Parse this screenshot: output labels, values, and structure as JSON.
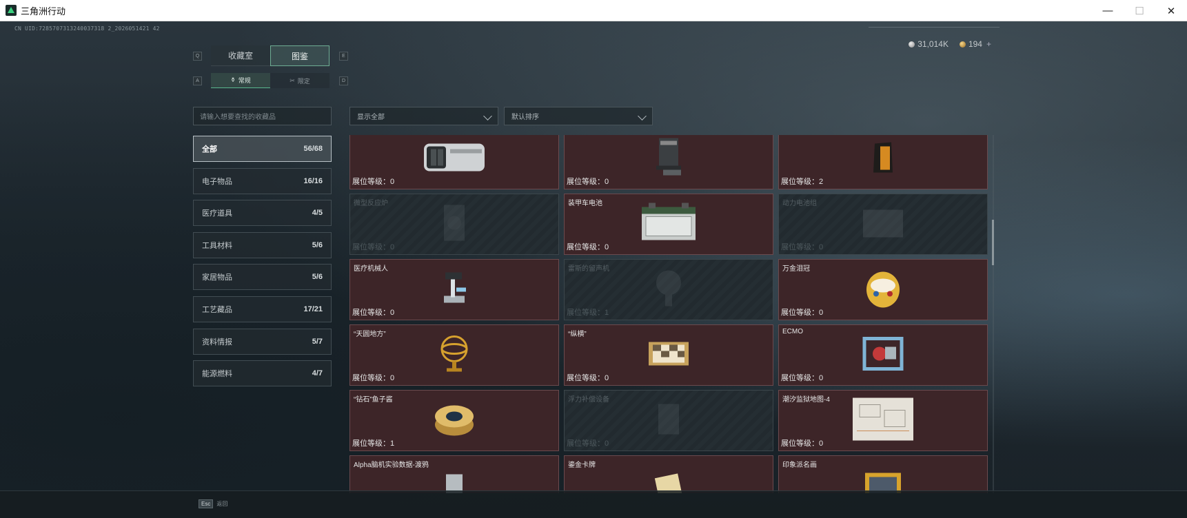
{
  "window": {
    "title": "三角洲行动",
    "minimize": "—",
    "maximize": "☐",
    "close": "✕"
  },
  "uid": "CN UID:7285707313240037318 2_2026051421 42",
  "currency": {
    "silver": "31,014K",
    "gold": "194",
    "add": "+"
  },
  "tabs": {
    "left_key": "Q",
    "right_key": "E",
    "items": [
      {
        "label": "收藏室"
      },
      {
        "label": "图鉴"
      }
    ]
  },
  "subtabs": {
    "left_key": "A",
    "right_key": "D",
    "items": [
      {
        "label": "常规",
        "icon": "⚱"
      },
      {
        "label": "限定",
        "icon": "✂"
      }
    ]
  },
  "search": {
    "placeholder": "请输入想要查找的收藏品"
  },
  "filters": {
    "show": "显示全部",
    "sort": "默认排序"
  },
  "categories": [
    {
      "label": "全部",
      "count": "56/68"
    },
    {
      "label": "电子物品",
      "count": "16/16"
    },
    {
      "label": "医疗道具",
      "count": "4/5"
    },
    {
      "label": "工具材料",
      "count": "5/6"
    },
    {
      "label": "家居物品",
      "count": "5/6"
    },
    {
      "label": "工艺藏品",
      "count": "17/21"
    },
    {
      "label": "资料情报",
      "count": "5/7"
    },
    {
      "label": "能源燃料",
      "count": "4/7"
    }
  ],
  "level_prefix": "展位等级：",
  "items": [
    {
      "name": "",
      "level": "展位等级：0",
      "locked": false,
      "icon": "server-icon"
    },
    {
      "name": "",
      "level": "展位等级：0",
      "locked": false,
      "icon": "coffee-machine-icon"
    },
    {
      "name": "",
      "level": "展位等级：2",
      "locked": false,
      "icon": "coffee-bag-icon"
    },
    {
      "name": "微型反应炉",
      "level": "展位等级：0",
      "locked": true,
      "icon": "reactor-icon"
    },
    {
      "name": "装甲车电池",
      "level": "展位等级：0",
      "locked": false,
      "icon": "battery-icon"
    },
    {
      "name": "动力电池组",
      "level": "展位等级：0",
      "locked": true,
      "icon": "battery-pack-icon"
    },
    {
      "name": "医疗机械人",
      "level": "展位等级：0",
      "locked": false,
      "icon": "robot-arm-icon"
    },
    {
      "name": "雷斯的留声机",
      "level": "展位等级：1",
      "locked": true,
      "icon": "gramophone-icon"
    },
    {
      "name": "万金泪冠",
      "level": "展位等级：0",
      "locked": false,
      "icon": "jeweled-egg-icon"
    },
    {
      "name": "“天圆地方”",
      "level": "展位等级：0",
      "locked": false,
      "icon": "armillary-sphere-icon"
    },
    {
      "name": "“纵横”",
      "level": "展位等级：0",
      "locked": false,
      "icon": "chessboard-icon"
    },
    {
      "name": "ECMO",
      "level": "展位等级：0",
      "locked": false,
      "icon": "ecmo-icon"
    },
    {
      "name": "“钻石”鱼子酱",
      "level": "展位等级：1",
      "locked": false,
      "icon": "caviar-tin-icon"
    },
    {
      "name": "浮力补偿设备",
      "level": "展位等级：0",
      "locked": true,
      "icon": "buoyancy-device-icon"
    },
    {
      "name": "潮汐监狱地图-4",
      "level": "展位等级：0",
      "locked": false,
      "icon": "map-icon"
    },
    {
      "name": "Alpha脑机实验数据-渡鸦",
      "level": "",
      "locked": false,
      "icon": "data-drive-icon"
    },
    {
      "name": "鎏金卡牌",
      "level": "",
      "locked": false,
      "icon": "gold-card-icon"
    },
    {
      "name": "印象派名画",
      "level": "",
      "locked": false,
      "icon": "painting-icon"
    }
  ],
  "footer": {
    "key": "Esc",
    "label": "返回"
  },
  "colors": {
    "accent": "#59b88f",
    "card_bg": "#3d2528",
    "locked_bg": "#252e33"
  }
}
